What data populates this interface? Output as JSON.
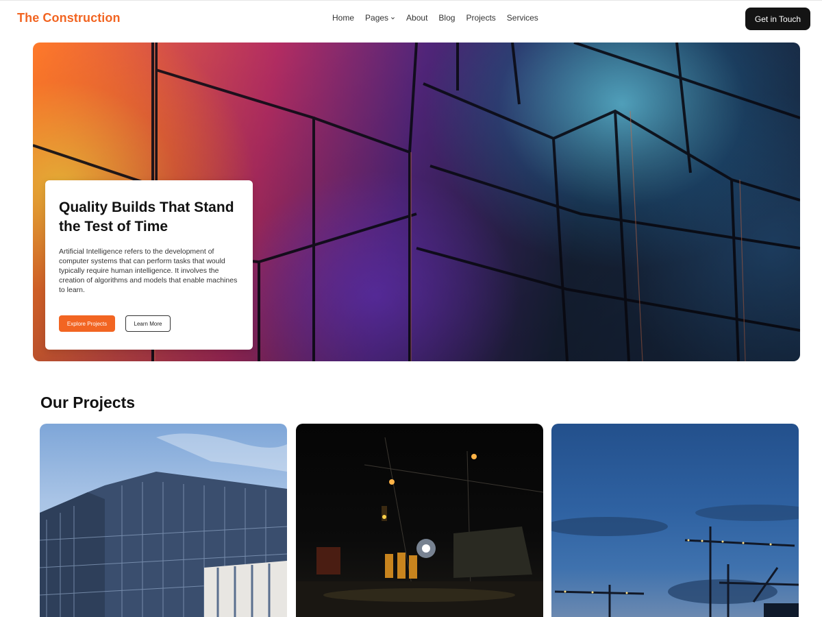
{
  "header": {
    "brand": "The Construction",
    "nav": [
      {
        "label": "Home"
      },
      {
        "label": "Pages",
        "has_dropdown": true
      },
      {
        "label": "About"
      },
      {
        "label": "Blog"
      },
      {
        "label": "Projects"
      },
      {
        "label": "Services"
      }
    ],
    "cta_label": "Get in Touch"
  },
  "hero": {
    "title": "Quality Builds That Stand the Test of Time",
    "description": "Artificial Intelligence refers to the development of computer systems that can perform tasks that would typically require human intelligence. It involves the creation of algorithms and models that enable machines to learn.",
    "primary_button": "Explore Projects",
    "secondary_button": "Learn More"
  },
  "projects": {
    "title": "Our Projects",
    "items": [
      {
        "image": "glass-office-building"
      },
      {
        "image": "night-road-construction-crew"
      },
      {
        "image": "tower-cranes-at-dusk"
      }
    ]
  },
  "colors": {
    "accent": "#f26522",
    "dark": "#141414",
    "text": "#111111"
  }
}
